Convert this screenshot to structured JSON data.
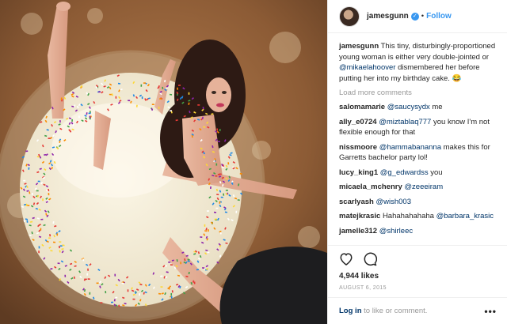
{
  "post": {
    "username": "jamesgunn",
    "follow_label": "Follow",
    "separator": "•",
    "verified_glyph": "✓",
    "caption": {
      "user": "jamesgunn",
      "text_before": "This tiny, disturbingly-proportioned young woman is either very double-jointed or ",
      "mention": "@mikaelahoover",
      "text_after": " dismembered her before putting her into my birthday cake. 😂"
    },
    "load_more": "Load more comments",
    "comments": [
      {
        "user": "salomamarie",
        "mention": "@saucysydx",
        "text": " me"
      },
      {
        "user": "ally_e0724",
        "mention": "@miztablaq777",
        "text": " you know I'm not flexible enough for that"
      },
      {
        "user": "nissmoore",
        "mention": "@hammabananna",
        "text": " makes this for Garretts bachelor party lol!"
      },
      {
        "user": "lucy_king1",
        "mention": "@g_edwardss",
        "text": " you"
      },
      {
        "user": "micaela_mchenry",
        "mention": "@zeeeiram",
        "text": ""
      },
      {
        "user": "scarlyash",
        "mention": "@wish003",
        "text": ""
      },
      {
        "user": "matejkrasic",
        "mention": "",
        "text": "Hahahahahaha",
        "mention2": "@barbara_krasic"
      },
      {
        "user": "jamelle312",
        "mention": "@shirleec",
        "text": ""
      }
    ],
    "likes": "4,944 likes",
    "date": "AUGUST 6, 2015",
    "login_link": "Log in",
    "login_rest": " to like or comment.",
    "more_options": "•••"
  },
  "icons": {
    "like": "heart-icon",
    "comment": "comment-icon",
    "verified": "verified-badge-icon"
  },
  "colors": {
    "link": "#003569",
    "accent": "#3897f0",
    "muted": "#999999"
  }
}
